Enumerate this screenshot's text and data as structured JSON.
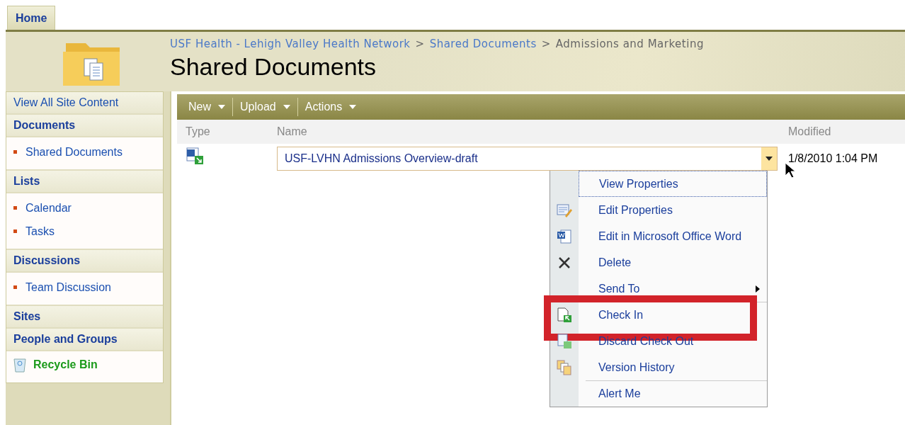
{
  "top_tabs": [
    {
      "label": "Home",
      "selected": true
    }
  ],
  "breadcrumb": [
    {
      "label": "USF Health - Lehigh Valley Health Network",
      "kind": "link"
    },
    {
      "label": ">",
      "kind": "separator"
    },
    {
      "label": "Shared Documents",
      "kind": "link"
    },
    {
      "label": ">",
      "kind": "separator"
    },
    {
      "label": "Admissions and Marketing",
      "kind": "current"
    }
  ],
  "page_title": "Shared Documents",
  "nav": {
    "top_link": "View All Site Content",
    "sections": [
      {
        "heading": "Documents",
        "items": [
          "Shared Documents"
        ]
      },
      {
        "heading": "Lists",
        "items": [
          "Calendar",
          "Tasks"
        ]
      },
      {
        "heading": "Discussions",
        "items": [
          "Team Discussion"
        ]
      },
      {
        "heading": "Sites"
      },
      {
        "heading": "People and Groups"
      }
    ],
    "recycle_bin": "Recycle Bin"
  },
  "toolbar": [
    "New",
    "Upload",
    "Actions"
  ],
  "table": {
    "columns": [
      "Type",
      "Name",
      "Modified"
    ],
    "rows": [
      {
        "name": "USF-LVHN Admissions Overview-draft",
        "modified": "1/8/2010 1:04 PM",
        "selected": true
      }
    ]
  },
  "context_menu": [
    {
      "label": "View Properties",
      "kind": "none",
      "selected": true,
      "divider": false,
      "submenu": false,
      "callout": false
    },
    {
      "label": "Edit Properties",
      "kind": "properties",
      "selected": false,
      "divider": false,
      "submenu": false,
      "callout": false
    },
    {
      "label": "Edit in Microsoft Office Word",
      "kind": "word",
      "selected": false,
      "divider": false,
      "submenu": false,
      "callout": false
    },
    {
      "label": "Delete",
      "kind": "delete",
      "selected": false,
      "divider": false,
      "submenu": false,
      "callout": false
    },
    {
      "label": "Send To",
      "kind": "none",
      "selected": false,
      "divider": false,
      "submenu": true,
      "callout": false
    },
    {
      "label": "Check In",
      "kind": "checkin",
      "selected": false,
      "divider": true,
      "submenu": false,
      "callout": true
    },
    {
      "label": "Discard Check Out",
      "kind": "discard",
      "selected": false,
      "divider": false,
      "submenu": false,
      "callout": false
    },
    {
      "label": "Version History",
      "kind": "versions",
      "selected": false,
      "divider": false,
      "submenu": false,
      "callout": false
    },
    {
      "label": "Alert Me",
      "kind": "none",
      "selected": false,
      "divider": true,
      "submenu": false,
      "callout": false
    }
  ]
}
